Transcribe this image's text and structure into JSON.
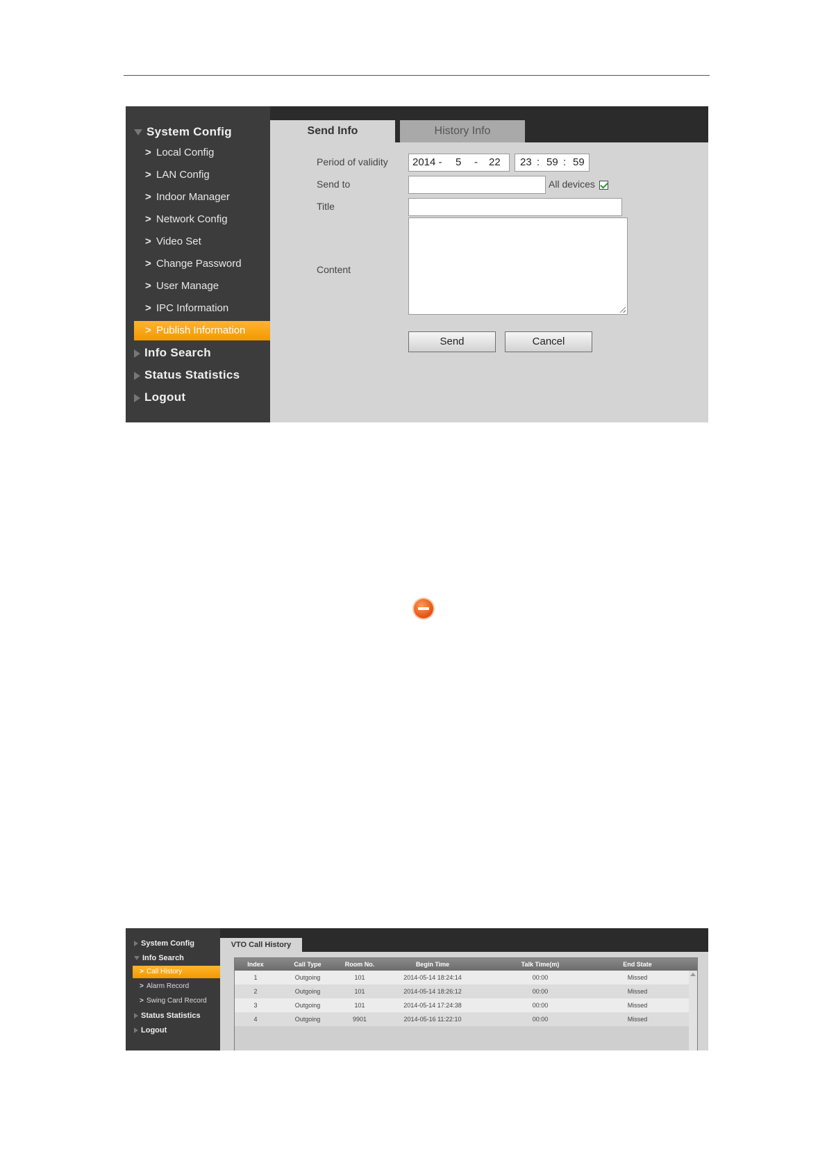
{
  "shot1": {
    "sidebar": {
      "system_config": "System Config",
      "items": [
        {
          "label": "Local Config"
        },
        {
          "label": "LAN Config"
        },
        {
          "label": "Indoor Manager"
        },
        {
          "label": "Network Config"
        },
        {
          "label": "Video Set"
        },
        {
          "label": "Change Password"
        },
        {
          "label": "User Manage"
        },
        {
          "label": "IPC Information"
        },
        {
          "label": "Publish Information",
          "active": true
        }
      ],
      "info_search": "Info Search",
      "status_statistics": "Status Statistics",
      "logout": "Logout"
    },
    "tabs": {
      "send_info": "Send Info",
      "history_info": "History Info"
    },
    "form": {
      "period_label": "Period of validity",
      "date": {
        "year": "2014 -",
        "month": "5",
        "sep": "-",
        "day": "22"
      },
      "time": {
        "hour": "23",
        "sep1": ":",
        "minute": "59",
        "sep2": ":",
        "second": "59"
      },
      "send_to_label": "Send to",
      "send_to_value": "",
      "all_devices_label": "All devices",
      "all_devices_checked": true,
      "title_label": "Title",
      "title_value": "",
      "content_label": "Content",
      "content_value": "",
      "send_button": "Send",
      "cancel_button": "Cancel"
    }
  },
  "shot2": {
    "sidebar": {
      "system_config": "System Config",
      "info_search": "Info Search",
      "items": [
        {
          "label": "Call History",
          "active": true
        },
        {
          "label": "Alarm Record"
        },
        {
          "label": "Swing Card Record"
        }
      ],
      "status_statistics": "Status Statistics",
      "logout": "Logout"
    },
    "tab": "VTO Call History",
    "table": {
      "headers": [
        "Index",
        "Call Type",
        "Room No.",
        "Begin Time",
        "Talk Time(m)",
        "End State"
      ],
      "rows": [
        [
          "1",
          "Outgoing",
          "101",
          "2014-05-14 18:24:14",
          "00:00",
          "Missed"
        ],
        [
          "2",
          "Outgoing",
          "101",
          "2014-05-14 18:26:12",
          "00:00",
          "Missed"
        ],
        [
          "3",
          "Outgoing",
          "101",
          "2014-05-14 17:24:38",
          "00:00",
          "Missed"
        ],
        [
          "4",
          "Outgoing",
          "9901",
          "2014-05-16 11:22:10",
          "00:00",
          "Missed"
        ]
      ]
    }
  },
  "colors": {
    "accent": "#f29a00",
    "sidebar_bg": "#3c3c3c",
    "content_bg": "#d4d4d4"
  },
  "icons": {
    "middle": "stop-icon"
  }
}
